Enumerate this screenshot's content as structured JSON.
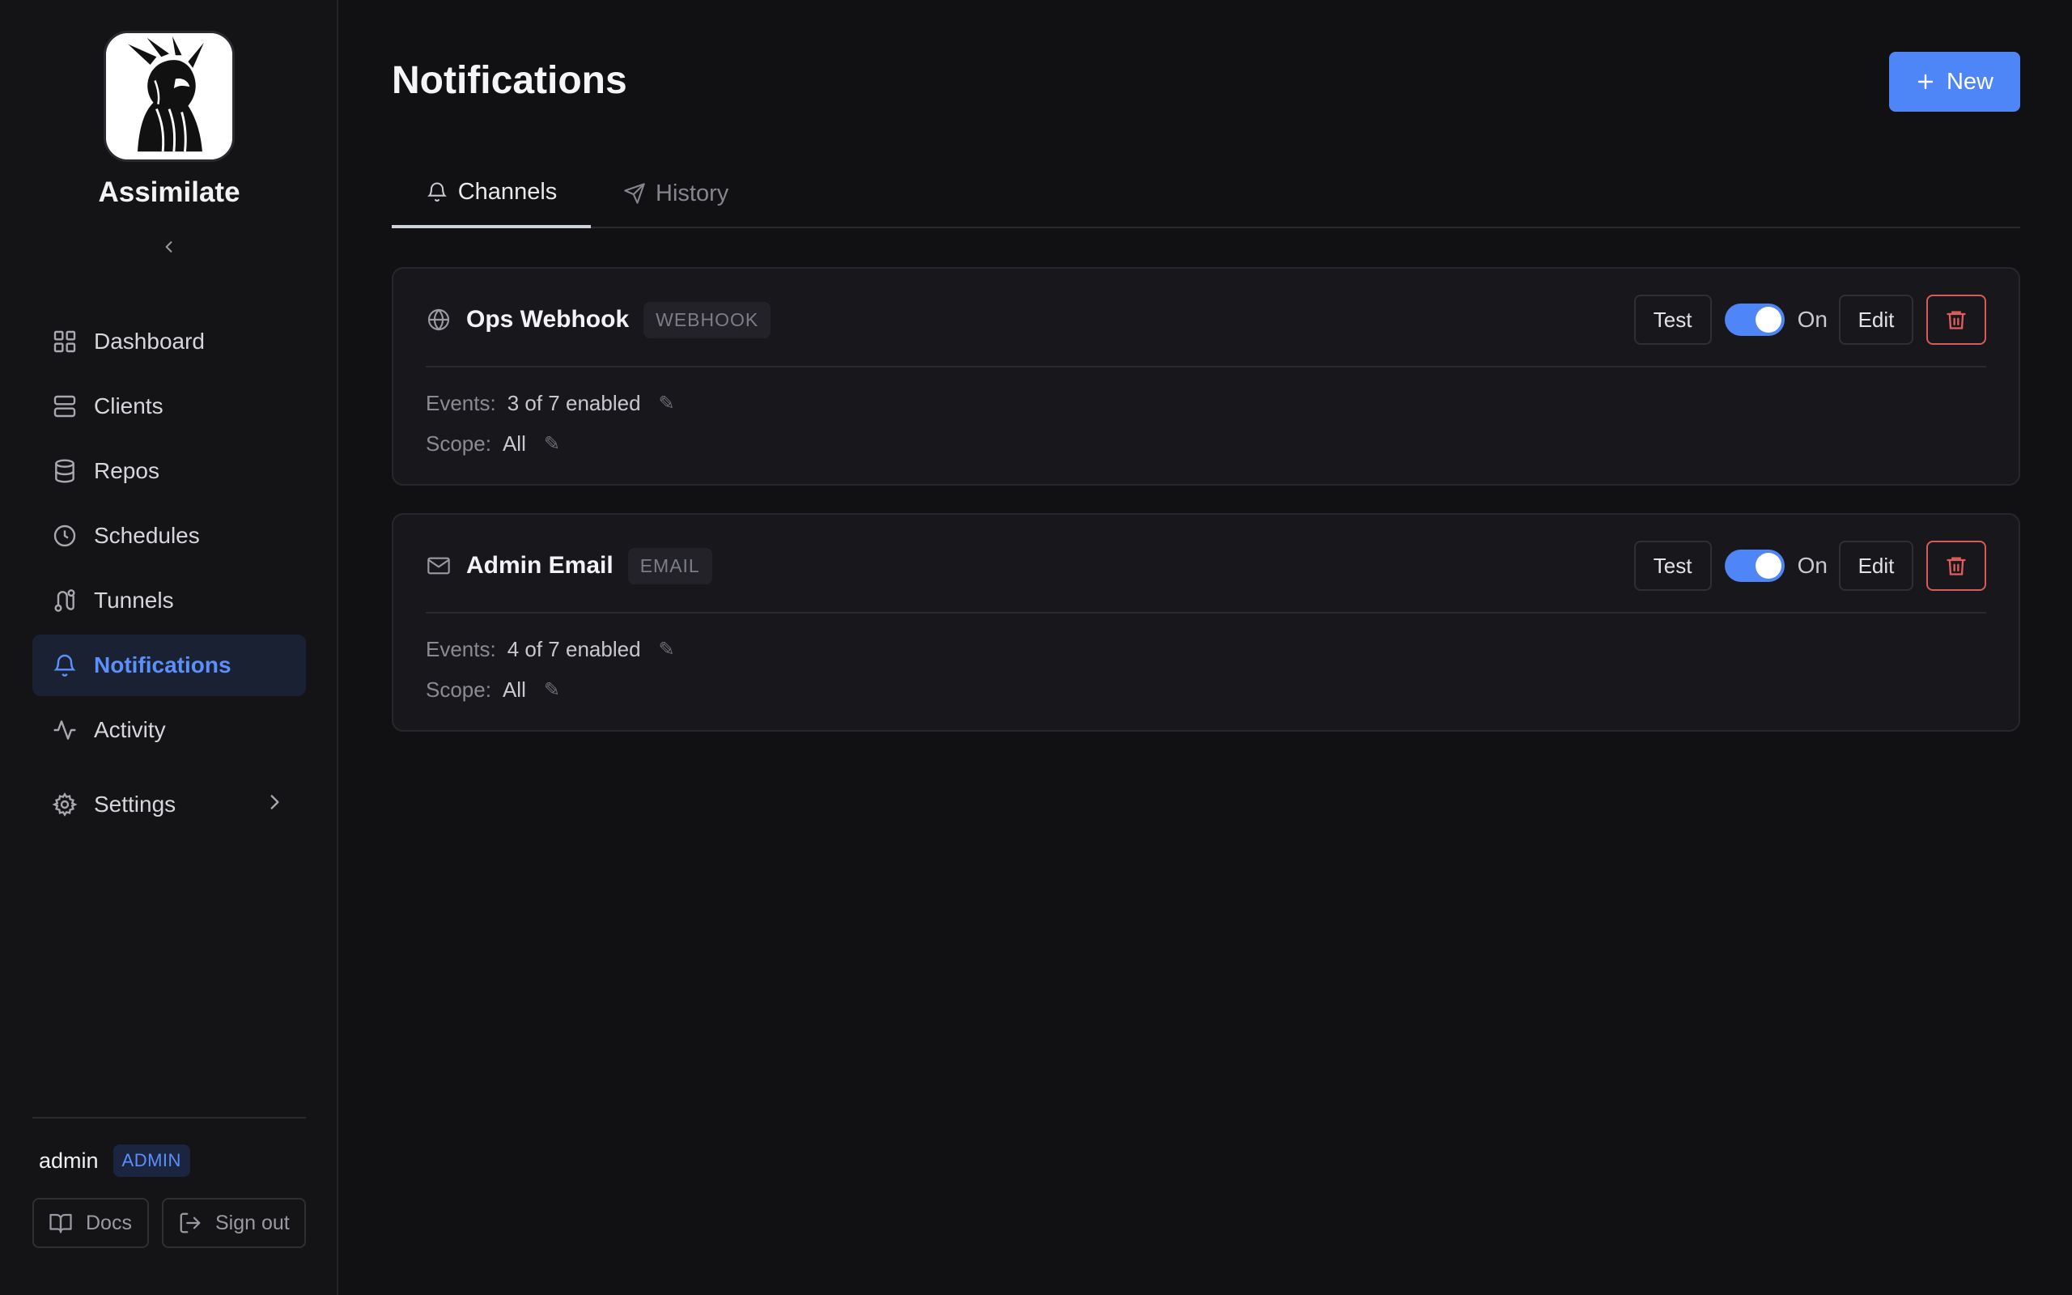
{
  "app": {
    "name": "Assimilate"
  },
  "sidebar": {
    "items": [
      {
        "label": "Dashboard",
        "icon": "grid-icon"
      },
      {
        "label": "Clients",
        "icon": "server-icon"
      },
      {
        "label": "Repos",
        "icon": "database-icon"
      },
      {
        "label": "Schedules",
        "icon": "clock-icon"
      },
      {
        "label": "Tunnels",
        "icon": "route-icon"
      },
      {
        "label": "Notifications",
        "icon": "bell-icon",
        "active": true
      },
      {
        "label": "Activity",
        "icon": "activity-icon"
      },
      {
        "label": "Settings",
        "icon": "gear-icon",
        "has_submenu": true
      }
    ],
    "user": {
      "name": "admin",
      "role": "ADMIN"
    },
    "footer": {
      "docs_label": "Docs",
      "signout_label": "Sign out"
    }
  },
  "page": {
    "title": "Notifications",
    "new_button_label": "New"
  },
  "tabs": [
    {
      "label": "Channels",
      "icon": "bell-icon",
      "active": true
    },
    {
      "label": "History",
      "icon": "send-icon",
      "active": false
    }
  ],
  "channels": [
    {
      "name": "Ops Webhook",
      "type": "WEBHOOK",
      "icon": "globe-icon",
      "test_label": "Test",
      "enabled": true,
      "toggle_label": "On",
      "edit_label": "Edit",
      "events_label": "Events:",
      "events_value": "3 of 7 enabled",
      "scope_label": "Scope:",
      "scope_value": "All"
    },
    {
      "name": "Admin Email",
      "type": "EMAIL",
      "icon": "mail-icon",
      "test_label": "Test",
      "enabled": true,
      "toggle_label": "On",
      "edit_label": "Edit",
      "events_label": "Events:",
      "events_value": "4 of 7 enabled",
      "scope_label": "Scope:",
      "scope_value": "All"
    }
  ],
  "colors": {
    "accent": "#4f86f7",
    "active_nav_text": "#5b8ff9",
    "danger": "#d95a5a",
    "background": "#111114"
  }
}
